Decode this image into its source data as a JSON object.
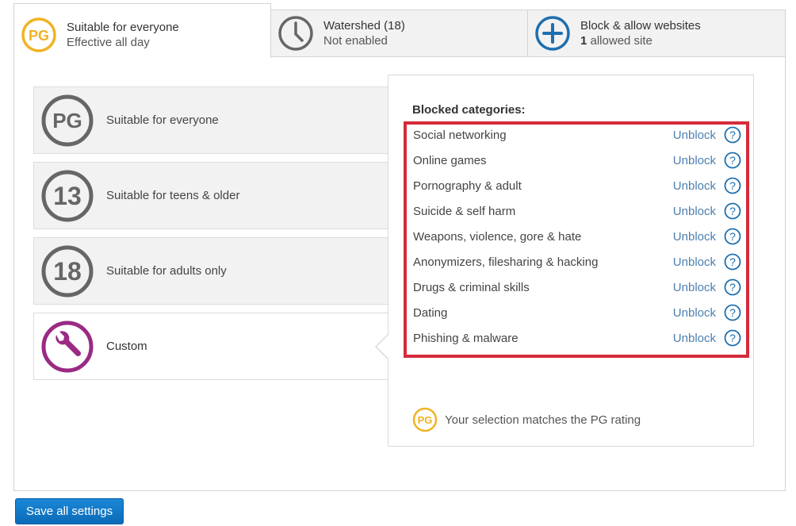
{
  "tabs": [
    {
      "icon": "pg-rating-icon",
      "title": "Suitable for everyone",
      "subtitle": "Effective all day",
      "active": true
    },
    {
      "icon": "clock-icon",
      "title": "Watershed (18)",
      "subtitle": "Not enabled",
      "active": false
    },
    {
      "icon": "plus-circle-icon",
      "title": "Block & allow websites",
      "subtitle_count": "1",
      "subtitle_text": " allowed site",
      "active": false
    }
  ],
  "ratings": [
    {
      "badge": "PG",
      "label": "Suitable for everyone",
      "icon": "pg-rating-icon"
    },
    {
      "badge": "13",
      "label": "Suitable for teens & older",
      "icon": "13-rating-icon"
    },
    {
      "badge": "18",
      "label": "Suitable for adults only",
      "icon": "18-rating-icon"
    },
    {
      "label": "Custom",
      "icon": "wrench-icon",
      "selected": true
    }
  ],
  "blocked": {
    "heading": "Blocked categories:",
    "action_label": "Unblock",
    "categories": [
      "Social networking",
      "Online games",
      "Pornography & adult",
      "Suicide & self harm",
      "Weapons, violence, gore & hate",
      "Anonymizers, filesharing & hacking",
      "Drugs & criminal skills",
      "Dating",
      "Phishing & malware"
    ]
  },
  "match": {
    "badge": "PG",
    "text": "Your selection matches the PG rating"
  },
  "save_label": "Save all settings",
  "colors": {
    "pg": "#f0b323",
    "grey_icon": "#666666",
    "blue": "#1d6fae",
    "custom": "#9a2a84",
    "highlight": "#d52b3a",
    "link": "#4c7fb0"
  }
}
